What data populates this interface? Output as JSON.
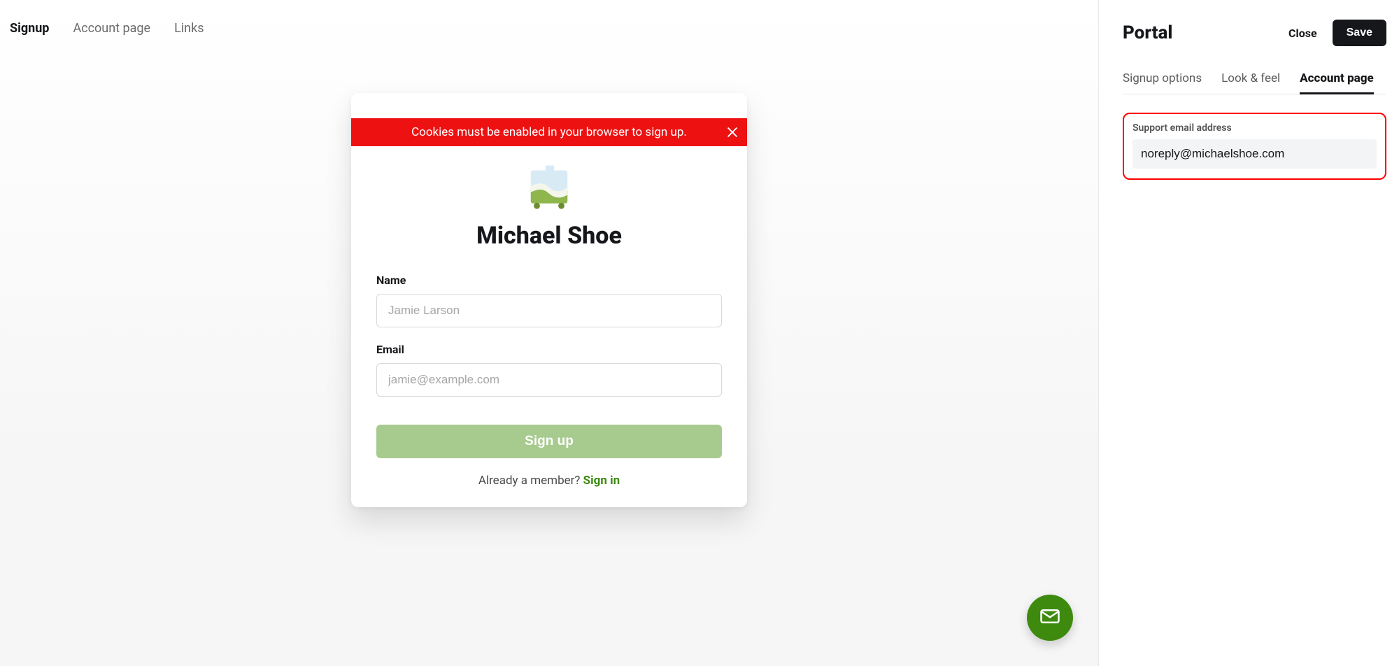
{
  "topnav": {
    "items": [
      "Signup",
      "Account page",
      "Links"
    ],
    "activeIndex": 0
  },
  "preview": {
    "alertText": "Cookies must be enabled in your browser to sign up.",
    "brandTitle": "Michael Shoe",
    "fields": {
      "nameLabel": "Name",
      "namePlaceholder": "Jamie Larson",
      "emailLabel": "Email",
      "emailPlaceholder": "jamie@example.com"
    },
    "signupButton": "Sign up",
    "alreadyPrefix": "Already a member? ",
    "signinLink": "Sign in"
  },
  "panel": {
    "title": "Portal",
    "closeLabel": "Close",
    "saveLabel": "Save",
    "tabs": [
      "Signup options",
      "Look & feel",
      "Account page"
    ],
    "activeTabIndex": 2,
    "supportEmailLabel": "Support email address",
    "supportEmailValue": "noreply@michaelshoe.com"
  }
}
